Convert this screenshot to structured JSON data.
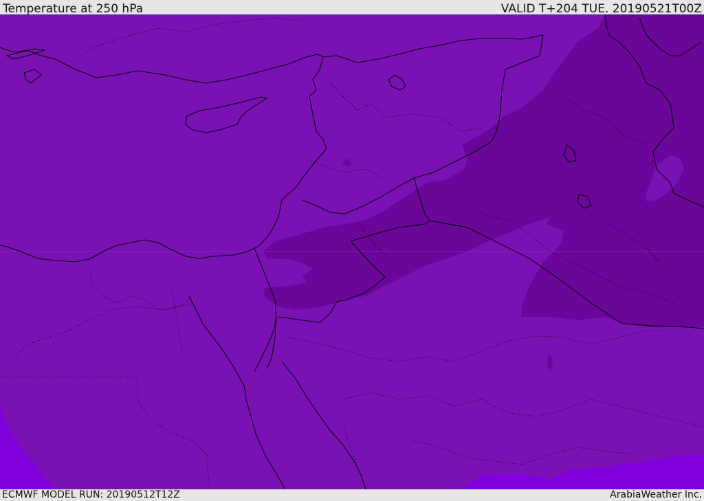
{
  "header": {
    "title": "Temperature at 250 hPa",
    "valid": "VALID T+204 TUE. 20190521T00Z"
  },
  "footer": {
    "model_run": "ECMWF MODEL RUN: 20190512T12Z",
    "credit": "ArabiaWeather Inc."
  },
  "map": {
    "colors": {
      "background_field": "#7a12b3",
      "cold_band": "#6a0599",
      "light_edge": "#8200de",
      "coast_line": "#000000",
      "border_line": "#000000"
    }
  }
}
